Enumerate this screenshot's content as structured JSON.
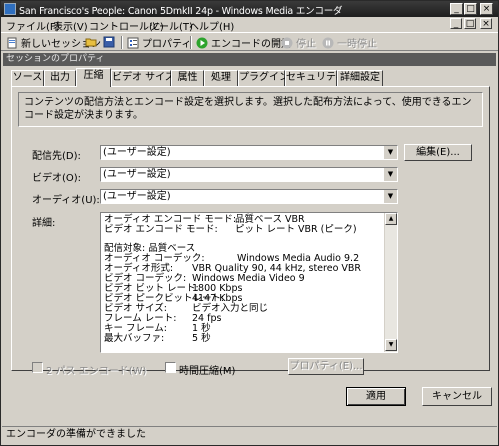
{
  "window": {
    "title": "San Francisco's People: Canon 5DmkII 24p - Windows Media エンコーダ",
    "controls": {
      "minimize": "_",
      "maximize": "□",
      "close": "×"
    }
  },
  "menubar": {
    "file": "ファイル(F)",
    "view": "表示(V)",
    "control": "コントロール(C)",
    "tools": "ツール(T)",
    "help": "ヘルプ(H)",
    "right_icons": {
      "minimize": "_",
      "restore": "□",
      "close": "×"
    }
  },
  "toolbar": {
    "new_session": "新しいセッション",
    "properties": "プロパティ",
    "start_encoding": "エンコードの開始",
    "stop": "停止",
    "pause": "一時停止"
  },
  "panel": {
    "header": "セッションのプロパティ"
  },
  "tabs": [
    "ソース",
    "出力",
    "圧縮",
    "ビデオ サイズ",
    "属性",
    "処理",
    "プラグイン",
    "セキュリティ",
    "詳細設定"
  ],
  "compression": {
    "description": "コンテンツの配信方法とエンコード設定を選択します。選択した配布方法によって、使用できるエンコード設定が決まります。",
    "destination_label": "配信先(D):",
    "destination_value": "(ユーザー設定)",
    "edit_button": "編集(E)...",
    "video_label": "ビデオ(O):",
    "video_value": "(ユーザー設定)",
    "audio_label": "オーディオ(U):",
    "audio_value": "(ユーザー設定)",
    "details_label": "詳細:",
    "details": {
      "audio_mode_label": "オーディオ エンコード モード:",
      "audio_mode_value": "品質ベース VBR",
      "video_mode_label": "ビデオ エンコード モード:",
      "video_mode_value": "ピット レート VBR (ピーク)",
      "target_label": "配信対象: 品質ベース",
      "rows": [
        {
          "label": "オーディオ コーデック:",
          "value": "Windows Media Audio 9.2"
        },
        {
          "label": "オーディオ形式:",
          "value": "VBR Quality 90, 44 kHz, stereo VBR"
        },
        {
          "label": "ビデオ コーデック:",
          "value": "Windows Media Video 9"
        },
        {
          "label": "ビデオ ビット レート:",
          "value": "1800 Kbps"
        },
        {
          "label": "ビデオ ピークビットレート:",
          "value": "4147 Kbps"
        },
        {
          "label": "ビデオ サイズ:",
          "value": "ビデオ入力と同じ"
        },
        {
          "label": "フレーム レート:",
          "value": "24 fps"
        },
        {
          "label": "キー フレーム:",
          "value": "1 秒"
        },
        {
          "label": "最大バッファ:",
          "value": "5 秒"
        }
      ]
    },
    "two_pass_label": "2 パス エンコード(W)",
    "time_compression_label": "時間圧縮(M)",
    "properties_button": "プロパティ(E)..."
  },
  "buttons": {
    "apply": "適用",
    "cancel": "キャンセル"
  },
  "status": "エンコーダの準備ができました",
  "colors": {
    "titlebar": "#2a2a2a",
    "face": "#d4d0c8",
    "panel_header": "#5a5a5a",
    "start_green": "#2da42d"
  }
}
